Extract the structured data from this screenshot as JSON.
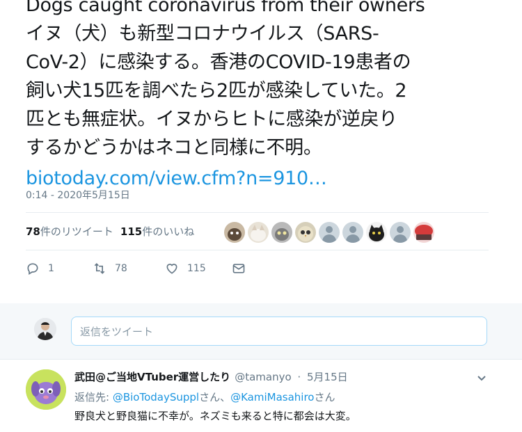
{
  "tweet": {
    "lines": [
      "Dogs caught coronavirus from their owners",
      "イヌ（犬）も新型コロナウイルス（SARS-",
      "CoV-2）に感染する。香港のCOVID-19患者の",
      "飼い犬15匹を調べたら2匹が感染していた。2",
      "匹とも無症状。イヌからヒトに感染が逆戻り",
      "するかどうかはネコと同様に不明。"
    ],
    "link": "biotoday.com/view.cfm?n=910…",
    "timestamp": "0:14 - 2020年5月15日"
  },
  "stats": {
    "retweets_count": "78",
    "retweets_label": "件のリツイート",
    "likes_count": "115",
    "likes_label": "件のいいね"
  },
  "liker_avatars": [
    "photo-cat",
    "photo-cat-white",
    "photo-cat-gray",
    "photo-owl",
    "default-avatar",
    "default-avatar",
    "photo-black-cat",
    "default-avatar",
    "photo-red"
  ],
  "actions": {
    "reply_count": "1",
    "retweet_count": "78",
    "like_count": "115"
  },
  "reply_box": {
    "placeholder": "返信をツイート"
  },
  "reply": {
    "author_name": "武田@ご当地VTuber運営したり",
    "author_handle": "@tamanyo",
    "sep": "·",
    "date": "5月15日",
    "replying_to_prefix": "返信先: ",
    "mention1": "@BioTodaySuppl",
    "mention_suffix1": "さん、",
    "mention2": "@KamiMasahiro",
    "mention_suffix2": "さん",
    "text": "野良犬と野良猫に不幸が。ネズミも来ると特に都会は大変。"
  },
  "colors": {
    "link": "#1b95e0",
    "muted": "#657786",
    "text": "#14171a"
  }
}
